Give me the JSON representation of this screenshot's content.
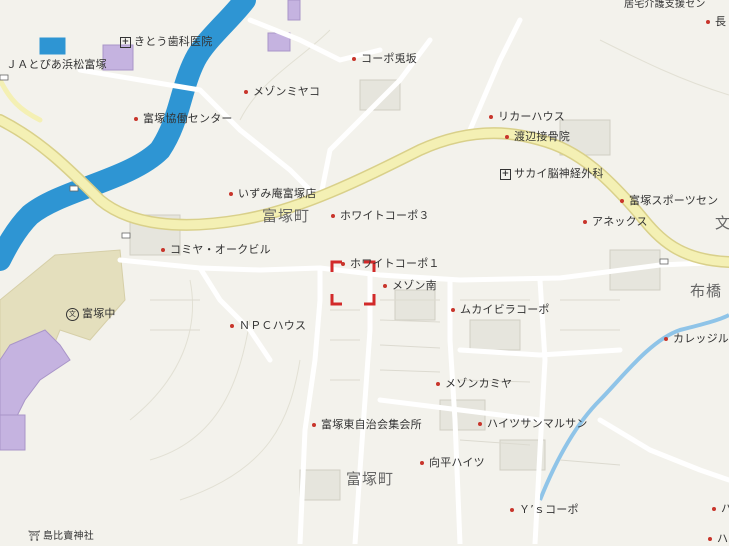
{
  "labels": {
    "kitou": "きとう歯科医院",
    "ja": "ＪＡとぴあ浜松富塚",
    "corpo_kensaka": "コーポ兎坂",
    "maison_miyako": "メゾンミヤコ",
    "tomizuka_kyodo": "富塚協働センター",
    "izumian": "いずみ庵富塚店",
    "white3": "ホワイトコーポ３",
    "komiya": "コミヤ・オークビル",
    "white1": "ホワイトコーポ１",
    "maison_minami": "メゾン南",
    "npc": "ＮＰＣハウス",
    "mukaihira": "ムカイビラコーポ",
    "maison_kamiya": "メゾンカミヤ",
    "jichikai": "富塚東自治会集会所",
    "heights_sanmaru": "ハイツサンマルサン",
    "mukaihira_heights": "向平ハイツ",
    "ys_corpo": "Ｙ’ｓコーポ",
    "shrine": "島比賣神社",
    "school": "富塚中",
    "ricker": "リカーハウス",
    "watanabe": "渡辺接骨院",
    "sakai": "サカイ脳神経外科",
    "tomizuka_sports": "富塚スポーツセン",
    "annex": "アネックス",
    "calledge": "カレッジル",
    "chou": "長",
    "top_right": "居宅介護支援セン",
    "ha": "ハ",
    "ha2": "ハ"
  },
  "districts": {
    "d1": "富塚町",
    "d2": "富塚町",
    "d3": "布橋",
    "d4": "文"
  },
  "colors": {
    "background": "#f3f2ec",
    "river": "#2e95d3",
    "main_road": "#f4f0b4",
    "main_road_edge": "#d9d08a",
    "road": "#ffffff",
    "road_edge": "#d0cec4",
    "building_purple": "#c5b3e0",
    "school_ground": "#e4dfbd",
    "poi_dot": "#c8352b",
    "marker": "#d22a2a"
  },
  "icons": {
    "hospital": "hospital-cross-icon",
    "school": "school-icon",
    "shrine": "shrine-torii-icon",
    "poi": "poi-dot-icon",
    "location": "location-bracket-marker"
  }
}
